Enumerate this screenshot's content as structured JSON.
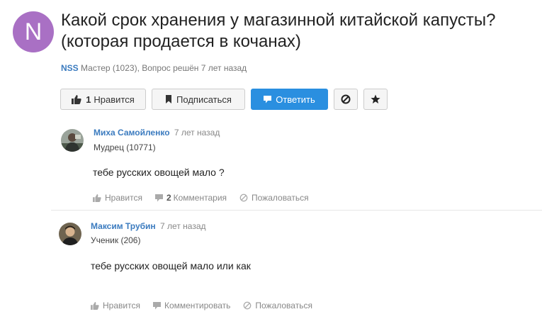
{
  "question": {
    "avatar_letter": "N",
    "title": "Какой срок хранения у магазинной китайской капусты? (которая продается в кочанах)",
    "author": "NSS",
    "author_rank": "Мастер (1023)",
    "status": ", Вопрос решён 7 лет назад"
  },
  "toolbar": {
    "like_count": "1",
    "like_label": "Нравится",
    "subscribe_label": "Подписаться",
    "answer_label": "Ответить"
  },
  "answers": [
    {
      "name": "Миха Самойленко",
      "time": "7 лет назад",
      "rank": "Мудрец (10771)",
      "text": "тебе русских овощей мало ?",
      "like_label": "Нравится",
      "comments_count": "2",
      "comments_label": "Комментария",
      "report_label": "Пожаловаться"
    },
    {
      "name": "Максим Трубин",
      "time": "7 лет назад",
      "rank": "Ученик (206)",
      "text": "тебе русских овощей мало или как",
      "like_label": "Нравится",
      "comments_label": "Комментировать",
      "report_label": "Пожаловаться"
    }
  ]
}
